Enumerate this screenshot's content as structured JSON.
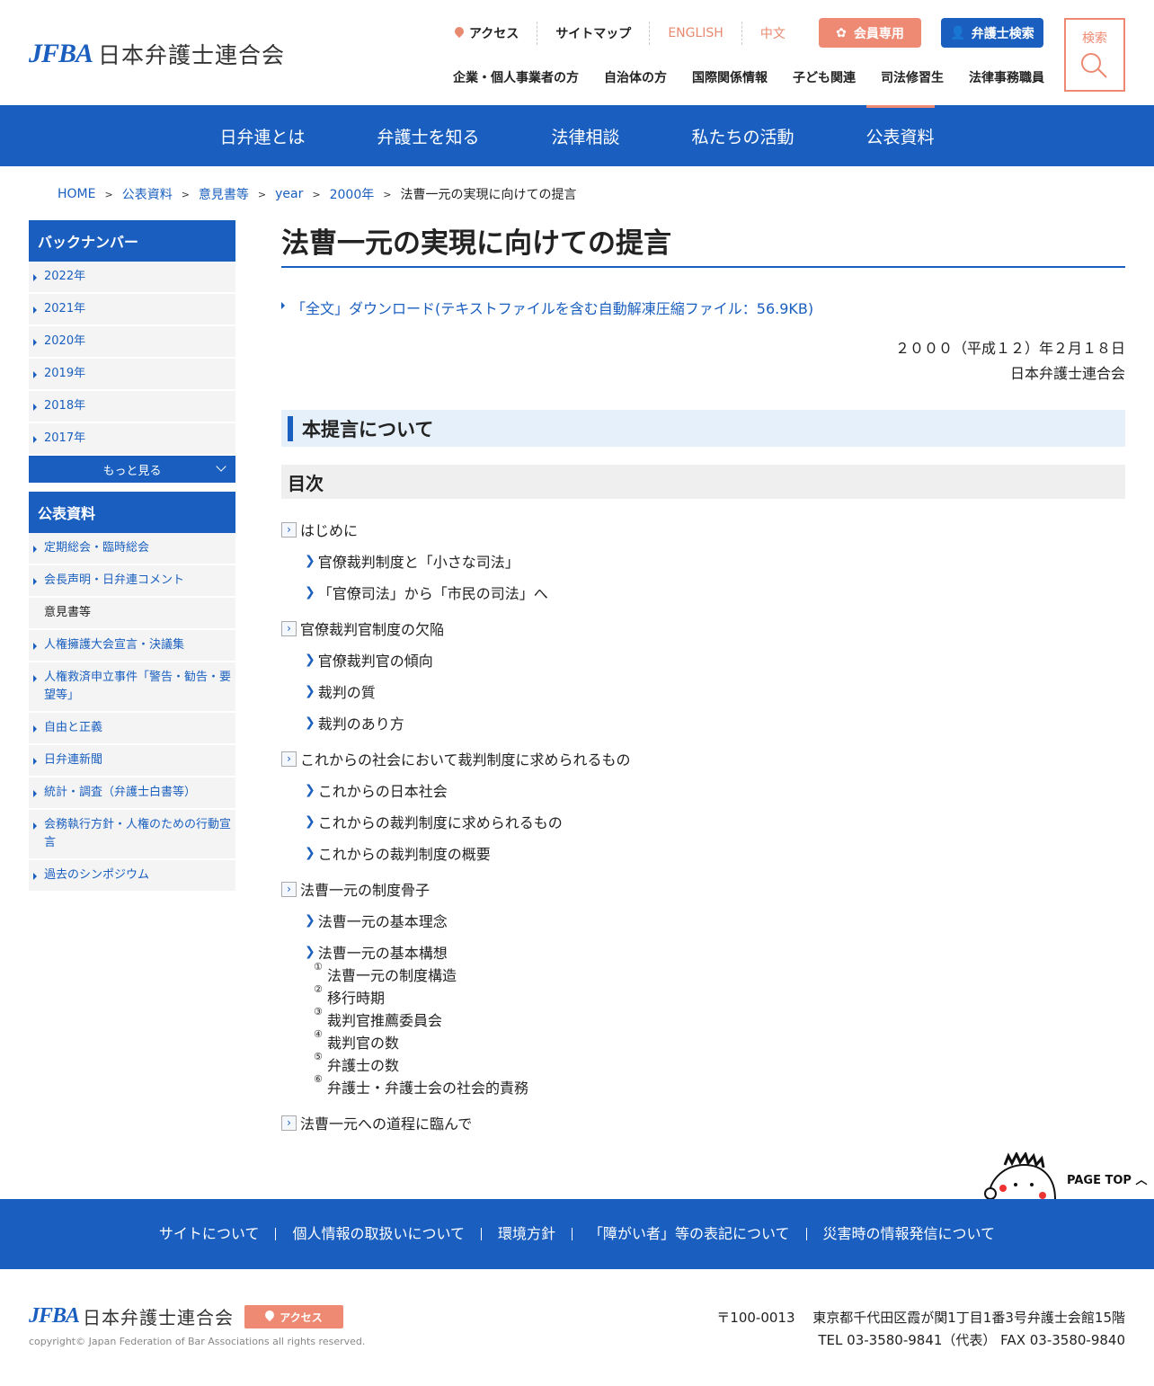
{
  "header": {
    "logo_mark": "JFBA",
    "logo_text": "日本弁護士連合会",
    "util": [
      "アクセス",
      "サイトマップ",
      "ENGLISH",
      "中文"
    ],
    "member_btn": "会員専用",
    "lawyer_btn": "弁護士検索",
    "search_label": "検索",
    "subnav": [
      "企業・個人事業者の方",
      "自治体の方",
      "国際関係情報",
      "子ども関連",
      "司法修習生",
      "法律事務職員"
    ]
  },
  "mainnav": [
    "日弁連とは",
    "弁護士を知る",
    "法律相談",
    "私たちの活動",
    "公表資料"
  ],
  "breadcrumb": [
    "HOME",
    "公表資料",
    "意見書等",
    "year",
    "2000年",
    "法曹一元の実現に向けての提言"
  ],
  "sidebar": {
    "back_title": "バックナンバー",
    "years": [
      "2022年",
      "2021年",
      "2020年",
      "2019年",
      "2018年",
      "2017年"
    ],
    "more": "もっと見る",
    "pub_title": "公表資料",
    "pub_items": [
      "定期総会・臨時総会",
      "会長声明・日弁連コメント",
      "意見書等",
      "人権擁護大会宣言・決議集",
      "人権救済申立事件「警告・勧告・要望等」",
      "自由と正義",
      "日弁連新聞",
      "統計・調査（弁護士白書等）",
      "会務執行方針・人権のための行動宣言",
      "過去のシンポジウム"
    ]
  },
  "main": {
    "title": "法曹一元の実現に向けての提言",
    "download": "「全文」ダウンロード(テキストファイルを含む自動解凍圧縮ファイル：56.9KB)",
    "date": "２０００（平成１２）年２月１８日",
    "org": "日本弁護士連合会",
    "section": "本提言について",
    "toc_title": "目次",
    "toc": [
      {
        "title": "はじめに",
        "children": [
          "官僚裁判制度と「小さな司法」",
          "「官僚司法」から「市民の司法」へ"
        ]
      },
      {
        "title": "官僚裁判官制度の欠陥",
        "children": [
          "官僚裁判官の傾向",
          "裁判の質",
          "裁判のあり方"
        ]
      },
      {
        "title": "これからの社会において裁判制度に求められるもの",
        "children": [
          "これからの日本社会",
          "これからの裁判制度に求められるもの",
          "これからの裁判制度の概要"
        ]
      },
      {
        "title": "法曹一元の制度骨子",
        "children": [
          "法曹一元の基本理念",
          "法曹一元の基本構想"
        ],
        "sub": [
          {
            "num": "①",
            "text": "法曹一元の制度構造"
          },
          {
            "num": "②",
            "text": "移行時期"
          },
          {
            "num": "③",
            "text": "裁判官推薦委員会"
          },
          {
            "num": "④",
            "text": "裁判官の数"
          },
          {
            "num": "⑤",
            "text": "弁護士の数"
          },
          {
            "num": "⑥",
            "text": "弁護士・弁護士会の社会的責務"
          }
        ]
      },
      {
        "title": "法曹一元への道程に臨んで",
        "children": []
      }
    ]
  },
  "pagetop": "PAGE TOP",
  "footer": {
    "links": [
      "サイトについて",
      "個人情報の取扱いについて",
      "環境方針",
      "「障がい者」等の表記について",
      "災害時の情報発信について"
    ],
    "logo_mark": "JFBA",
    "logo_text": "日本弁護士連合会",
    "access": "アクセス",
    "copyright": "copyright© Japan Federation of Bar Associations all rights reserved.",
    "address": "〒100-0013　 東京都千代田区霞が関1丁目1番3号弁護士会館15階",
    "tel": "TEL 03-3580-9841（代表） FAX 03-3580-9840"
  },
  "colors": {
    "brand": "#1a5fbf",
    "accent": "#ee8a73"
  }
}
